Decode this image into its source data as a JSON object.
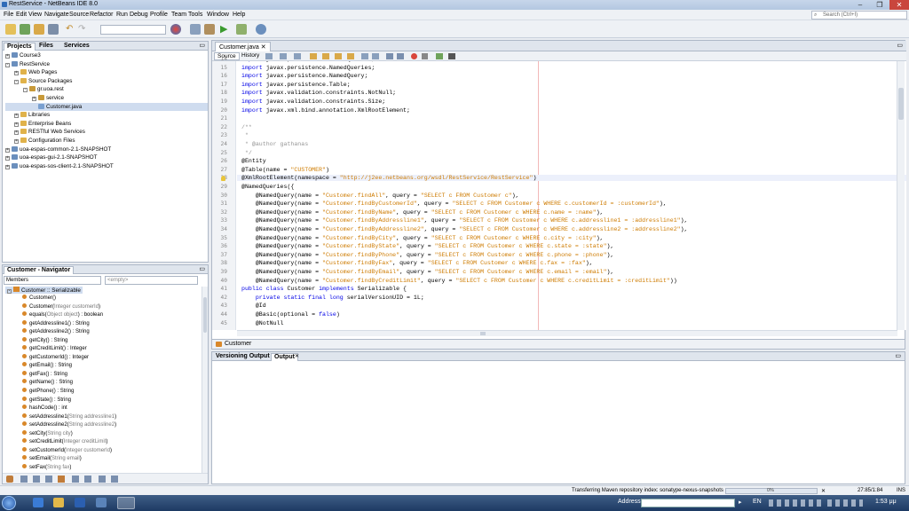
{
  "window": {
    "title": "RestService - NetBeans IDE 8.0"
  },
  "menu": [
    "File",
    "Edit",
    "View",
    "Navigate",
    "Source",
    "Refactor",
    "Run",
    "Debug",
    "Profile",
    "Team",
    "Tools",
    "Window",
    "Help"
  ],
  "search": {
    "placeholder": "Search (Ctrl+I)"
  },
  "projects_panel": {
    "tabs": [
      "Projects",
      "Files",
      "Services"
    ],
    "tree": [
      {
        "label": "Course3",
        "level": 0,
        "kind": "project"
      },
      {
        "label": "RestService",
        "level": 0,
        "kind": "project"
      },
      {
        "label": "Web Pages",
        "level": 1,
        "kind": "folder"
      },
      {
        "label": "Source Packages",
        "level": 1,
        "kind": "folder"
      },
      {
        "label": "gr.uoa.rest",
        "level": 2,
        "kind": "package"
      },
      {
        "label": "service",
        "level": 3,
        "kind": "package"
      },
      {
        "label": "Customer.java",
        "level": 3,
        "kind": "java"
      },
      {
        "label": "Libraries",
        "level": 1,
        "kind": "folder"
      },
      {
        "label": "Enterprise Beans",
        "level": 1,
        "kind": "folder"
      },
      {
        "label": "RESTful Web Services",
        "level": 1,
        "kind": "folder"
      },
      {
        "label": "Configuration Files",
        "level": 1,
        "kind": "folder"
      },
      {
        "label": "uoa-espas-common-2.1-SNAPSHOT",
        "level": 0,
        "kind": "project"
      },
      {
        "label": "uoa-espas-gui-2.1-SNAPSHOT",
        "level": 0,
        "kind": "project"
      },
      {
        "label": "uoa-espas-sos-client-2.1-SNAPSHOT",
        "level": 0,
        "kind": "project"
      }
    ]
  },
  "navigator": {
    "title": "Customer - Navigator",
    "filter": "Members",
    "filter2": "<empty>",
    "root": "Customer :: Serializable",
    "members": [
      [
        "Customer()",
        ""
      ],
      [
        "Customer(",
        "Integer customerId",
        ")",
        ""
      ],
      [
        "equals(",
        "Object object",
        ") : boolean",
        ""
      ],
      [
        "getAddressline1() : String"
      ],
      [
        "getAddressline2() : String"
      ],
      [
        "getCity() : String"
      ],
      [
        "getCreditLimit() : Integer"
      ],
      [
        "getCustomerId() : Integer"
      ],
      [
        "getEmail() : String"
      ],
      [
        "getFax() : String"
      ],
      [
        "getName() : String"
      ],
      [
        "getPhone() : String"
      ],
      [
        "getState() : String"
      ],
      [
        "hashCode() : int"
      ],
      [
        "setAddressline1(",
        "String addressline1",
        ")",
        ""
      ],
      [
        "setAddressline2(",
        "String addressline2",
        ")",
        ""
      ],
      [
        "setCity(",
        "String city",
        ")",
        ""
      ],
      [
        "setCreditLimit(",
        "Integer creditLimit",
        ")",
        ""
      ],
      [
        "setCustomerId(",
        "Integer customerId",
        ")",
        ""
      ],
      [
        "setEmail(",
        "String email",
        ")",
        ""
      ],
      [
        "setFax(",
        "String fax",
        ")",
        ""
      ]
    ]
  },
  "editor": {
    "file_tab": "Customer.java",
    "view_tabs": [
      "Source",
      "History"
    ],
    "breadcrumb": "Customer",
    "lines": [
      {
        "n": "14",
        "t": [
          [
            "kw",
            "import "
          ],
          [
            "",
            "javax.persistence.NamedQueries;"
          ]
        ]
      },
      {
        "n": "15",
        "t": [
          [
            "kw",
            "import "
          ],
          [
            "",
            "javax.persistence.NamedQueries;"
          ]
        ]
      },
      {
        "n": "16",
        "t": [
          [
            "kw",
            "import "
          ],
          [
            "",
            "javax.persistence.NamedQuery;"
          ]
        ]
      },
      {
        "n": "17",
        "t": [
          [
            "kw",
            "import "
          ],
          [
            "",
            "javax.persistence.Table;"
          ]
        ]
      },
      {
        "n": "18",
        "t": [
          [
            "kw",
            "import "
          ],
          [
            "",
            "javax.validation.constraints.NotNull;"
          ]
        ]
      },
      {
        "n": "19",
        "t": [
          [
            "kw",
            "import "
          ],
          [
            "",
            "javax.validation.constraints.Size;"
          ]
        ]
      },
      {
        "n": "20",
        "t": [
          [
            "kw",
            "import "
          ],
          [
            "",
            "javax.xml.bind.annotation.XmlRootElement;"
          ]
        ]
      },
      {
        "n": "21",
        "t": []
      },
      {
        "n": "22",
        "t": [
          [
            "cm",
            "/**"
          ]
        ]
      },
      {
        "n": "23",
        "t": [
          [
            "cm",
            " *"
          ]
        ]
      },
      {
        "n": "24",
        "t": [
          [
            "cm",
            " * @author gathanas"
          ]
        ]
      },
      {
        "n": "25",
        "t": [
          [
            "cm",
            " */"
          ]
        ]
      },
      {
        "n": "26",
        "t": [
          [
            "",
            "@Entity"
          ]
        ]
      },
      {
        "n": "27",
        "t": [
          [
            "",
            "@Table(name = "
          ],
          [
            "str",
            "\"CUSTOMER\""
          ],
          [
            "",
            ")"
          ]
        ]
      },
      {
        "n": "28",
        "t": [
          [
            "",
            "@XmlRootElement(namespace = "
          ],
          [
            "str",
            "\"http://j2ee.netbeans.org/wsdl/RestService/RestService\""
          ],
          [
            "",
            ")"
          ]
        ],
        "hl": true
      },
      {
        "n": "29",
        "t": [
          [
            "",
            "@NamedQueries({"
          ]
        ]
      },
      {
        "n": "30",
        "t": [
          [
            "",
            "    @NamedQuery(name = "
          ],
          [
            "str",
            "\"Customer.findAll\""
          ],
          [
            "",
            ", query = "
          ],
          [
            "str",
            "\"SELECT c FROM Customer c\""
          ],
          [
            "",
            "),"
          ]
        ]
      },
      {
        "n": "31",
        "t": [
          [
            "",
            "    @NamedQuery(name = "
          ],
          [
            "str",
            "\"Customer.findByCustomerId\""
          ],
          [
            "",
            ", query = "
          ],
          [
            "str",
            "\"SELECT c FROM Customer c WHERE c.customerId = :customerId\""
          ],
          [
            "",
            "),"
          ]
        ]
      },
      {
        "n": "32",
        "t": [
          [
            "",
            "    @NamedQuery(name = "
          ],
          [
            "str",
            "\"Customer.findByName\""
          ],
          [
            "",
            ", query = "
          ],
          [
            "str",
            "\"SELECT c FROM Customer c WHERE c.name = :name\""
          ],
          [
            "",
            "),"
          ]
        ]
      },
      {
        "n": "33",
        "t": [
          [
            "",
            "    @NamedQuery(name = "
          ],
          [
            "str",
            "\"Customer.findByAddressline1\""
          ],
          [
            "",
            ", query = "
          ],
          [
            "str",
            "\"SELECT c FROM Customer c WHERE c.addressline1 = :addressline1\""
          ],
          [
            "",
            "),"
          ]
        ]
      },
      {
        "n": "34",
        "t": [
          [
            "",
            "    @NamedQuery(name = "
          ],
          [
            "str",
            "\"Customer.findByAddressline2\""
          ],
          [
            "",
            ", query = "
          ],
          [
            "str",
            "\"SELECT c FROM Customer c WHERE c.addressline2 = :addressline2\""
          ],
          [
            "",
            "),"
          ]
        ]
      },
      {
        "n": "35",
        "t": [
          [
            "",
            "    @NamedQuery(name = "
          ],
          [
            "str",
            "\"Customer.findByCity\""
          ],
          [
            "",
            ", query = "
          ],
          [
            "str",
            "\"SELECT c FROM Customer c WHERE c.city = :city\""
          ],
          [
            "",
            "),"
          ]
        ]
      },
      {
        "n": "36",
        "t": [
          [
            "",
            "    @NamedQuery(name = "
          ],
          [
            "str",
            "\"Customer.findByState\""
          ],
          [
            "",
            ", query = "
          ],
          [
            "str",
            "\"SELECT c FROM Customer c WHERE c.state = :state\""
          ],
          [
            "",
            "),"
          ]
        ]
      },
      {
        "n": "37",
        "t": [
          [
            "",
            "    @NamedQuery(name = "
          ],
          [
            "str",
            "\"Customer.findByPhone\""
          ],
          [
            "",
            ", query = "
          ],
          [
            "str",
            "\"SELECT c FROM Customer c WHERE c.phone = :phone\""
          ],
          [
            "",
            "),"
          ]
        ]
      },
      {
        "n": "38",
        "t": [
          [
            "",
            "    @NamedQuery(name = "
          ],
          [
            "str",
            "\"Customer.findByFax\""
          ],
          [
            "",
            ", query = "
          ],
          [
            "str",
            "\"SELECT c FROM Customer c WHERE c.fax = :fax\""
          ],
          [
            "",
            "),"
          ]
        ]
      },
      {
        "n": "39",
        "t": [
          [
            "",
            "    @NamedQuery(name = "
          ],
          [
            "str",
            "\"Customer.findByEmail\""
          ],
          [
            "",
            ", query = "
          ],
          [
            "str",
            "\"SELECT c FROM Customer c WHERE c.email = :email\""
          ],
          [
            "",
            "),"
          ]
        ]
      },
      {
        "n": "40",
        "t": [
          [
            "",
            "    @NamedQuery(name = "
          ],
          [
            "str",
            "\"Customer.findByCreditLimit\""
          ],
          [
            "",
            ", query = "
          ],
          [
            "str",
            "\"SELECT c FROM Customer c WHERE c.creditLimit = :creditLimit\""
          ],
          [
            "",
            "))"
          ]
        ]
      },
      {
        "n": "41",
        "t": [
          [
            "kw",
            "public class "
          ],
          [
            "",
            "Customer "
          ],
          [
            "kw",
            "implements "
          ],
          [
            "",
            "Serializable {"
          ]
        ]
      },
      {
        "n": "42",
        "t": [
          [
            "kw",
            "    private static final long "
          ],
          [
            "",
            "serialVersionUID = 1L;"
          ]
        ]
      },
      {
        "n": "43",
        "t": [
          [
            "",
            "    @Id"
          ]
        ]
      },
      {
        "n": "44",
        "t": [
          [
            "",
            "    @Basic(optional = "
          ],
          [
            "kw",
            "false"
          ],
          [
            "",
            ")"
          ]
        ]
      },
      {
        "n": "45",
        "t": [
          [
            "",
            "    @NotNull"
          ]
        ]
      }
    ]
  },
  "output_panel": {
    "tabs": [
      "Versioning Output",
      "Output"
    ]
  },
  "status": {
    "message": "Transferring Maven repository index: sonatype-nexus-snapshots",
    "progress": "0%",
    "progress_fraction": 0.0,
    "position": "27:85/1:84",
    "mode": "INS"
  },
  "taskbar": {
    "address_label": "Address",
    "lang": "EN",
    "time": "1:53 μμ"
  },
  "colors": {
    "keyword": "#0000e6",
    "string": "#ce7b00",
    "comment": "#969696",
    "taskbar": "#1d3a63"
  }
}
